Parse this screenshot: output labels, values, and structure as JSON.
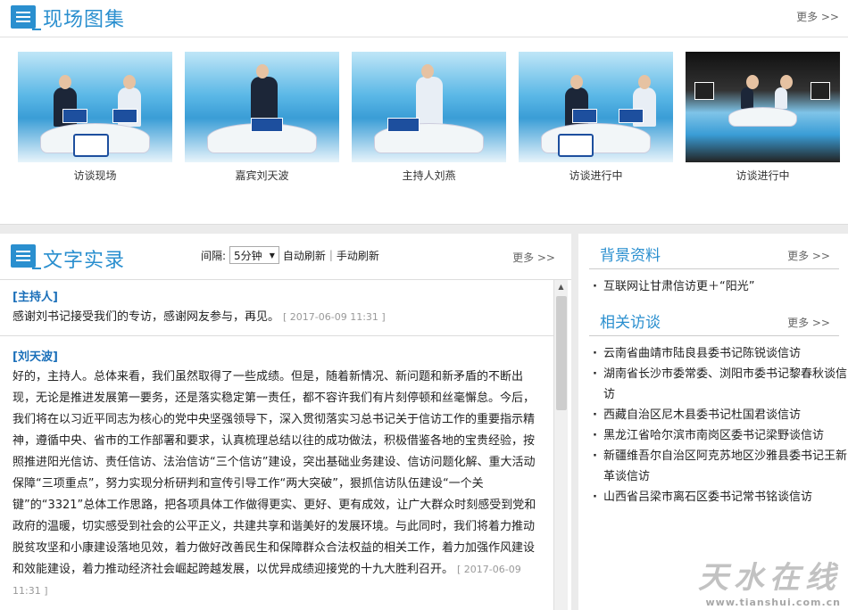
{
  "gallery": {
    "title": "现场图集",
    "more": "更多 >>",
    "photos": [
      {
        "caption": "访谈现场"
      },
      {
        "caption": "嘉宾刘天波"
      },
      {
        "caption": "主持人刘燕"
      },
      {
        "caption": "访谈进行中"
      },
      {
        "caption": "访谈进行中"
      }
    ]
  },
  "record": {
    "title": "文字实录",
    "interval_label": "间隔:",
    "interval_value": "5分钟",
    "auto_refresh": "自动刷新",
    "separator": "|",
    "manual_refresh": "手动刷新",
    "more": "更多 >>",
    "entries": [
      {
        "speaker": "[主持人]",
        "text": "感谢刘书记接受我们的专访，感谢网友参与，再见。",
        "time": "[ 2017-06-09 11:31 ]"
      },
      {
        "speaker": "[刘天波]",
        "text": "好的，主持人。总体来看，我们虽然取得了一些成绩。但是，随着新情况、新问题和新矛盾的不断出现，无论是推进发展第一要务，还是落实稳定第一责任，都不容许我们有片刻停顿和丝毫懈怠。今后，我们将在以习近平同志为核心的党中央坚强领导下，深入贯彻落实习总书记关于信访工作的重要指示精神，遵循中央、省市的工作部署和要求，认真梳理总结以往的成功做法，积极借鉴各地的宝贵经验，按照推进阳光信访、责任信访、法治信访“三个信访”建设，突出基础业务建设、信访问题化解、重大活动保障“三项重点”，努力实现分析研判和宣传引导工作“两大突破”，狠抓信访队伍建设“一个关键”的“3321”总体工作思路，把各项具体工作做得更实、更好、更有成效，让广大群众时刻感受到党和政府的温暖，切实感受到社会的公平正义，共建共享和谐美好的发展环境。与此同时，我们将着力推动脱贫攻坚和小康建设落地见效，着力做好改善民生和保障群众合法权益的相关工作，着力加强作风建设和效能建设，着力推动经济社会崛起跨越发展，以优异成绩迎接党的十九大胜利召开。",
        "time": "[ 2017-06-09 11:31 ]"
      }
    ]
  },
  "background": {
    "title": "背景资料",
    "more": "更多 >>",
    "items": [
      "互联网让甘肃信访更＋“阳光”"
    ]
  },
  "related": {
    "title": "相关访谈",
    "more": "更多 >>",
    "items": [
      "云南省曲靖市陆良县委书记陈锐谈信访",
      "湖南省长沙市委常委、浏阳市委书记黎春秋谈信访",
      "西藏自治区尼木县委书记杜国君谈信访",
      "黑龙江省哈尔滨市南岗区委书记梁野谈信访",
      "新疆维吾尔自治区阿克苏地区沙雅县委书记王新革谈信访",
      "山西省吕梁市离石区委书记常书铭谈信访"
    ]
  },
  "watermark": {
    "name": "天水在线",
    "url": "www.tianshui.com.cn"
  }
}
